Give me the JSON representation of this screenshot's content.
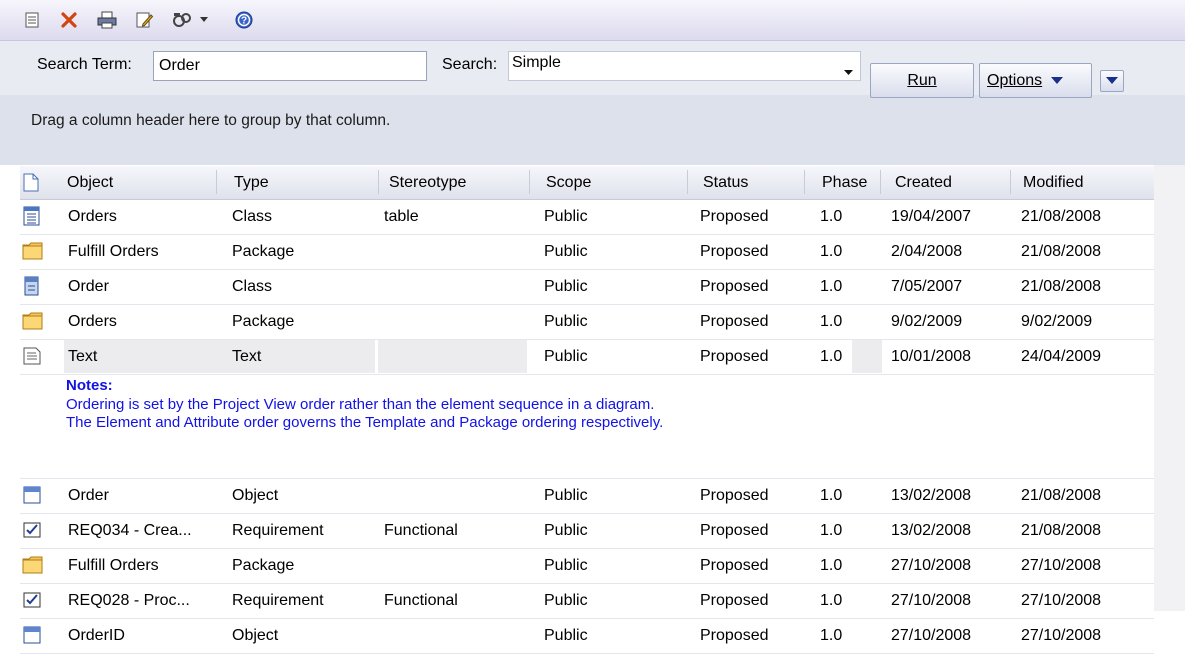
{
  "toolbar": {
    "icons": [
      "new-document-icon",
      "delete-icon",
      "print-icon",
      "edit-icon",
      "tools-icon",
      "dropdown-arrow-icon",
      "help-icon"
    ]
  },
  "search": {
    "term_label": "Search Term:",
    "term_value": "Order",
    "search_label": "Search:",
    "search_value": "Simple",
    "run_label": "Run",
    "options_label": "Options"
  },
  "group_hint": "Drag a column header here to group by that column.",
  "columns": [
    "Object",
    "Type",
    "Stereotype",
    "Scope",
    "Status",
    "Phase",
    "Created",
    "Modified"
  ],
  "rows": [
    {
      "icon": "table-class-icon",
      "object": "Orders",
      "type": "Class",
      "stereotype": "table",
      "scope": "Public",
      "status": "Proposed",
      "phase": "1.0",
      "created": "19/04/2007",
      "modified": "21/08/2008"
    },
    {
      "icon": "package-folder-icon",
      "object": "Fulfill Orders",
      "type": "Package",
      "stereotype": "",
      "scope": "Public",
      "status": "Proposed",
      "phase": "1.0",
      "created": "2/04/2008",
      "modified": "21/08/2008"
    },
    {
      "icon": "class-icon",
      "object": "Order",
      "type": "Class",
      "stereotype": "",
      "scope": "Public",
      "status": "Proposed",
      "phase": "1.0",
      "created": "7/05/2007",
      "modified": "21/08/2008"
    },
    {
      "icon": "package-folder-icon",
      "object": "Orders",
      "type": "Package",
      "stereotype": "",
      "scope": "Public",
      "status": "Proposed",
      "phase": "1.0",
      "created": "9/02/2009",
      "modified": "9/02/2009"
    },
    {
      "icon": "text-icon",
      "object": "Text",
      "type": "Text",
      "stereotype": "",
      "scope": "Public",
      "status": "Proposed",
      "phase": "1.0",
      "created": "10/01/2008",
      "modified": "24/04/2009"
    }
  ],
  "notes": {
    "title": "Notes:",
    "line1": "Ordering is set by the Project View order rather than the element sequence in a diagram.",
    "line2": "The Element and Attribute order governs the Template and Package ordering respectively."
  },
  "rows2": [
    {
      "icon": "object-icon",
      "object": "Order",
      "type": "Object",
      "stereotype": "",
      "scope": "Public",
      "status": "Proposed",
      "phase": "1.0",
      "created": "13/02/2008",
      "modified": "21/08/2008"
    },
    {
      "icon": "requirement-icon",
      "object": "REQ034 - Crea...",
      "type": "Requirement",
      "stereotype": "Functional",
      "scope": "Public",
      "status": "Proposed",
      "phase": "1.0",
      "created": "13/02/2008",
      "modified": "21/08/2008"
    },
    {
      "icon": "package-folder-icon",
      "object": "Fulfill Orders",
      "type": "Package",
      "stereotype": "",
      "scope": "Public",
      "status": "Proposed",
      "phase": "1.0",
      "created": "27/10/2008",
      "modified": "27/10/2008"
    },
    {
      "icon": "requirement-icon",
      "object": "REQ028 - Proc...",
      "type": "Requirement",
      "stereotype": "Functional",
      "scope": "Public",
      "status": "Proposed",
      "phase": "1.0",
      "created": "27/10/2008",
      "modified": "27/10/2008"
    },
    {
      "icon": "object-icon",
      "object": "OrderID",
      "type": "Object",
      "stereotype": "",
      "scope": "Public",
      "status": "Proposed",
      "phase": "1.0",
      "created": "27/10/2008",
      "modified": "27/10/2008"
    }
  ]
}
